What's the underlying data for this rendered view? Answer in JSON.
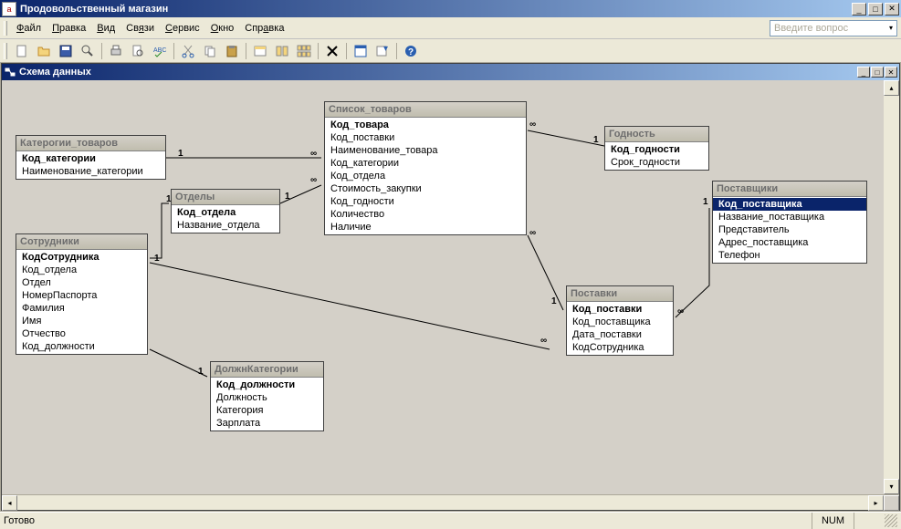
{
  "app": {
    "title": "Продовольственный магазин",
    "icon_letter": "a"
  },
  "menu": {
    "file": "Файл",
    "edit": "Правка",
    "view": "Вид",
    "relations": "Связи",
    "service": "Сервис",
    "window": "Окно",
    "help": "Справка",
    "help_placeholder": "Введите вопрос"
  },
  "child": {
    "title": "Схема данных"
  },
  "tables": {
    "categories": {
      "title": "Катерогии_товаров",
      "fields": [
        {
          "name": "Код_категории",
          "pk": true
        },
        {
          "name": "Наименование_категории"
        }
      ]
    },
    "departments": {
      "title": "Отделы",
      "fields": [
        {
          "name": "Код_отдела",
          "pk": true
        },
        {
          "name": "Название_отдела"
        }
      ]
    },
    "employees": {
      "title": "Сотрудники",
      "fields": [
        {
          "name": "КодСотрудника",
          "pk": true
        },
        {
          "name": "Код_отдела"
        },
        {
          "name": "Отдел"
        },
        {
          "name": "НомерПаспорта"
        },
        {
          "name": "Фамилия"
        },
        {
          "name": "Имя"
        },
        {
          "name": "Отчество"
        },
        {
          "name": "Код_должности"
        }
      ]
    },
    "position_categories": {
      "title": "ДолжнКатегории",
      "fields": [
        {
          "name": "Код_должности",
          "pk": true
        },
        {
          "name": "Должность"
        },
        {
          "name": "Категория"
        },
        {
          "name": "Зарплата"
        }
      ]
    },
    "products": {
      "title": "Список_товаров",
      "fields": [
        {
          "name": "Код_товара",
          "pk": true
        },
        {
          "name": "Код_поставки"
        },
        {
          "name": "Наименование_товара"
        },
        {
          "name": "Код_категории"
        },
        {
          "name": "Код_отдела"
        },
        {
          "name": "Стоимость_закупки"
        },
        {
          "name": "Код_годности"
        },
        {
          "name": "Количество"
        },
        {
          "name": "Наличие"
        }
      ]
    },
    "expiry": {
      "title": "Годность",
      "fields": [
        {
          "name": "Код_годности",
          "pk": true
        },
        {
          "name": "Срок_годности"
        }
      ]
    },
    "deliveries": {
      "title": "Поставки",
      "fields": [
        {
          "name": "Код_поставки",
          "pk": true
        },
        {
          "name": "Код_поставщика"
        },
        {
          "name": "Дата_поставки"
        },
        {
          "name": "КодСотрудника"
        }
      ]
    },
    "suppliers": {
      "title": "Поставщики",
      "fields": [
        {
          "name": "Код_поставщика",
          "pk": true,
          "selected": true
        },
        {
          "name": "Название_поставщика"
        },
        {
          "name": "Представитель"
        },
        {
          "name": "Адрес_поставщика"
        },
        {
          "name": "Телефон"
        }
      ]
    }
  },
  "relationships": [
    {
      "from": "categories",
      "to": "products",
      "type": "1-∞"
    },
    {
      "from": "departments",
      "to": "products",
      "type": "1-∞"
    },
    {
      "from": "departments",
      "to": "employees",
      "type": "1-∞"
    },
    {
      "from": "employees",
      "to": "position_categories",
      "type": "∞-1"
    },
    {
      "from": "employees",
      "to": "deliveries",
      "type": "1-∞"
    },
    {
      "from": "products",
      "to": "expiry",
      "type": "∞-1"
    },
    {
      "from": "products",
      "to": "deliveries",
      "type": "∞-1"
    },
    {
      "from": "deliveries",
      "to": "suppliers",
      "type": "∞-1"
    }
  ],
  "status": {
    "ready": "Готово",
    "num": "NUM"
  }
}
